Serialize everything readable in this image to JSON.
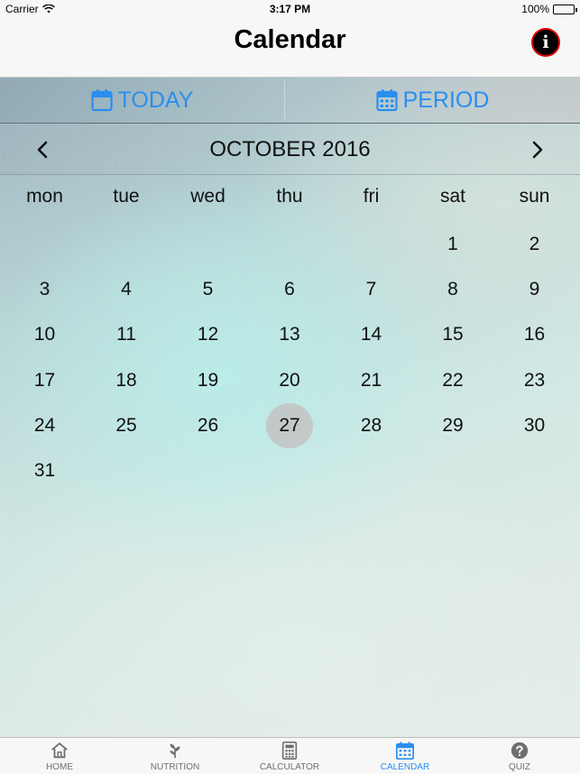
{
  "status_bar": {
    "carrier": "Carrier",
    "time": "3:17 PM",
    "battery": "100%"
  },
  "nav": {
    "title": "Calendar",
    "info_icon": "info-icon"
  },
  "segments": {
    "today": "TODAY",
    "period": "PERIOD",
    "accent": "#2a8ef0"
  },
  "calendar": {
    "month_title": "OCTOBER 2016",
    "weekdays": [
      "mon",
      "tue",
      "wed",
      "thu",
      "fri",
      "sat",
      "sun"
    ],
    "weeks": [
      [
        "",
        "",
        "",
        "",
        "",
        "1",
        "2"
      ],
      [
        "3",
        "4",
        "5",
        "6",
        "7",
        "8",
        "9"
      ],
      [
        "10",
        "11",
        "12",
        "13",
        "14",
        "15",
        "16"
      ],
      [
        "17",
        "18",
        "19",
        "20",
        "21",
        "22",
        "23"
      ],
      [
        "24",
        "25",
        "26",
        "27",
        "28",
        "29",
        "30"
      ],
      [
        "31",
        "",
        "",
        "",
        "",
        "",
        ""
      ]
    ],
    "highlighted_day": "27"
  },
  "tabs": [
    {
      "label": "HOME",
      "icon": "home-icon",
      "active": false
    },
    {
      "label": "NUTRITION",
      "icon": "leaf-icon",
      "active": false
    },
    {
      "label": "CALCULATOR",
      "icon": "calculator-icon",
      "active": false
    },
    {
      "label": "CALENDAR",
      "icon": "calendar-icon",
      "active": true
    },
    {
      "label": "QUIZ",
      "icon": "question-icon",
      "active": false
    }
  ]
}
